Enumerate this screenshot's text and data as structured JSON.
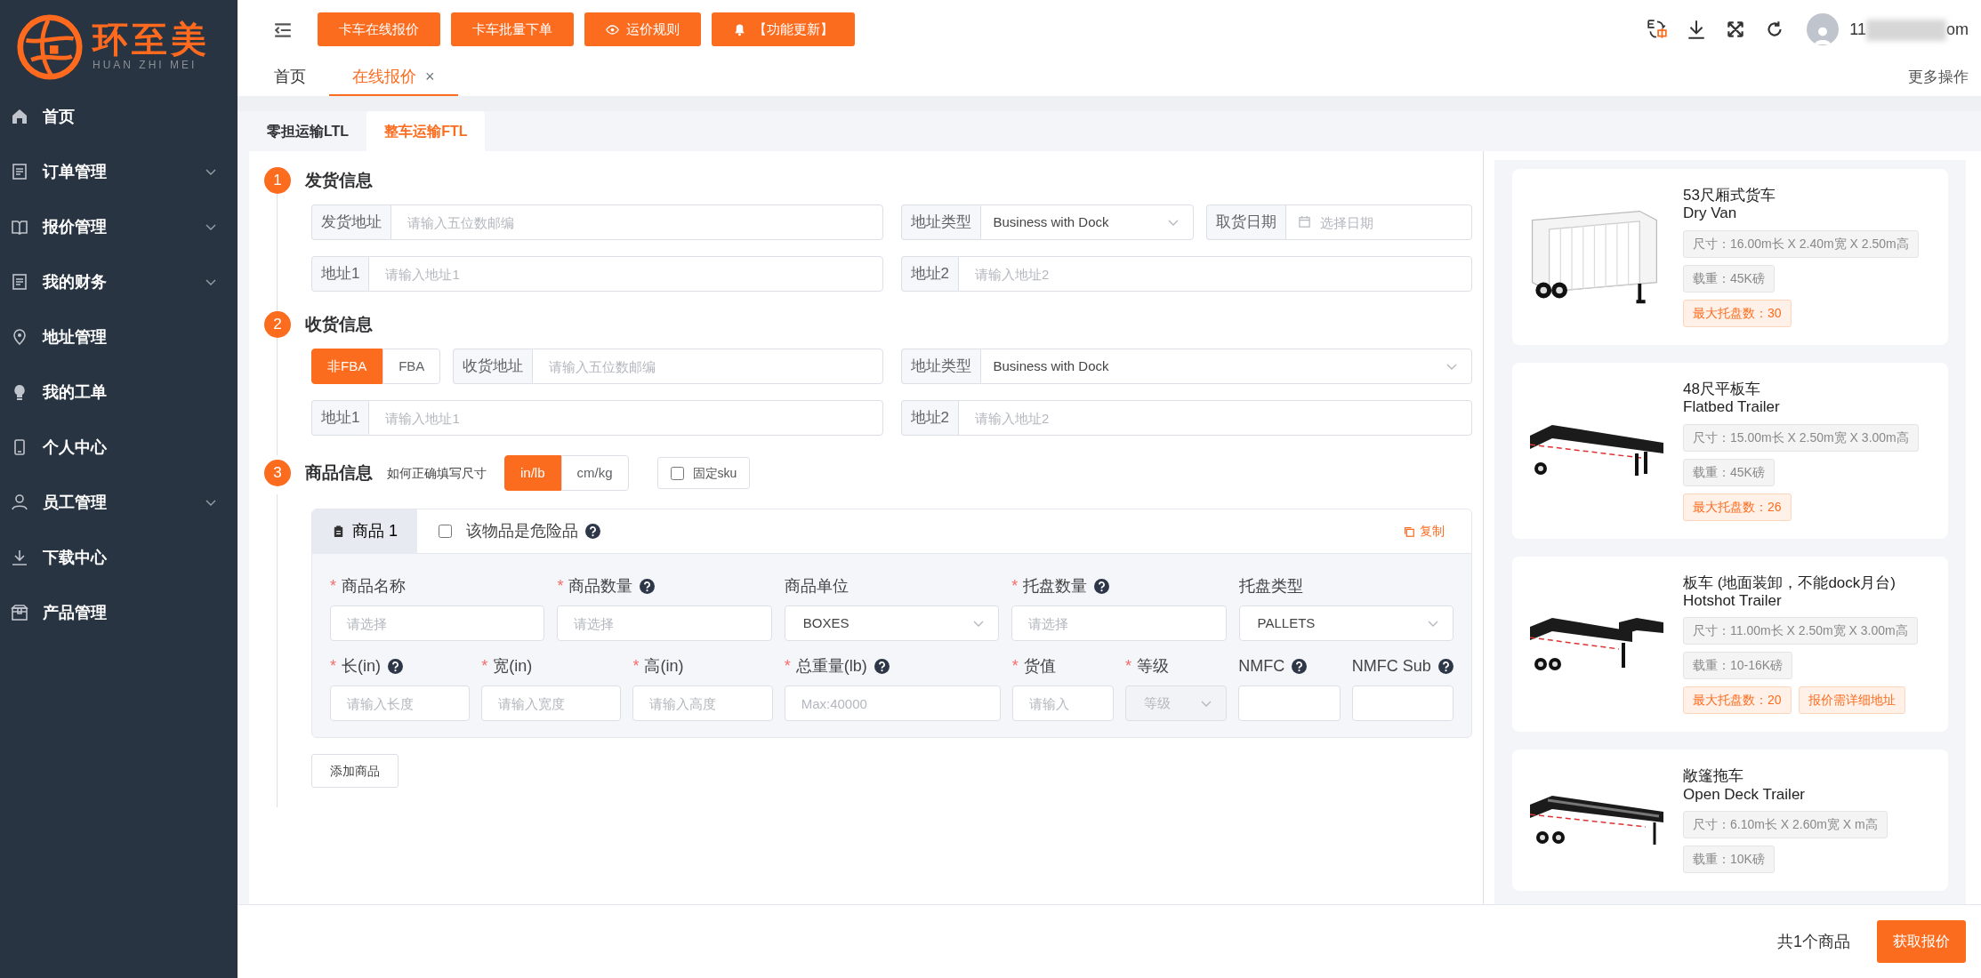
{
  "logo": {
    "name": "环至美",
    "subtitle": "HUAN ZHI MEI"
  },
  "sidebar": {
    "items": [
      {
        "label": "首页",
        "expandable": false
      },
      {
        "label": "订单管理",
        "expandable": true
      },
      {
        "label": "报价管理",
        "expandable": true
      },
      {
        "label": "我的财务",
        "expandable": true
      },
      {
        "label": "地址管理",
        "expandable": false
      },
      {
        "label": "我的工单",
        "expandable": false
      },
      {
        "label": "个人中心",
        "expandable": false
      },
      {
        "label": "员工管理",
        "expandable": true
      },
      {
        "label": "下载中心",
        "expandable": false
      },
      {
        "label": "产品管理",
        "expandable": false
      }
    ]
  },
  "toolbar": {
    "buttons": [
      {
        "label": "卡车在线报价",
        "kind": "text"
      },
      {
        "label": "卡车批量下单",
        "kind": "text"
      },
      {
        "label": "运价规则",
        "kind": "eye"
      },
      {
        "label": "【功能更新】",
        "kind": "bell"
      }
    ]
  },
  "user": {
    "visible_start": "11",
    "visible_end": "om"
  },
  "page_tabs": [
    {
      "label": "首页",
      "selected": false
    },
    {
      "label": "在线报价",
      "selected": true,
      "close": "×"
    }
  ],
  "more_actions": "更多操作",
  "mode_tabs": [
    {
      "label": "零担运输LTL",
      "selected": false
    },
    {
      "label": "整车运输FTL",
      "selected": true
    }
  ],
  "sections": [
    {
      "number": "1",
      "title": "发货信息",
      "rows": [
        {
          "left": [
            {
              "kind": "input",
              "label": "发货地址",
              "placeholder": "请输入五位数邮编"
            }
          ],
          "right": [
            {
              "kind": "select",
              "label": "地址类型",
              "value": "Business with Dock"
            },
            {
              "kind": "date",
              "label": "取货日期",
              "placeholder": "选择日期"
            }
          ]
        },
        {
          "left": [
            {
              "kind": "input",
              "label": "地址1",
              "placeholder": "请输入地址1"
            }
          ],
          "right": [
            {
              "kind": "input",
              "label": "地址2",
              "placeholder": "请输入地址2"
            }
          ]
        }
      ]
    },
    {
      "number": "2",
      "title": "收货信息",
      "rows": [
        {
          "left": [
            {
              "kind": "toggle",
              "options": [
                {
                  "label": "非FBA",
                  "selected": true
                },
                {
                  "label": "FBA",
                  "selected": false
                }
              ]
            },
            {
              "kind": "input",
              "label": "收货地址",
              "placeholder": "请输入五位数邮编"
            }
          ],
          "right": [
            {
              "kind": "select",
              "label": "地址类型",
              "value": "Business with Dock"
            }
          ]
        },
        {
          "left": [
            {
              "kind": "input",
              "label": "地址1",
              "placeholder": "请输入地址1"
            }
          ],
          "right": [
            {
              "kind": "input",
              "label": "地址2",
              "placeholder": "请输入地址2"
            }
          ]
        }
      ]
    }
  ],
  "goods": {
    "number": "3",
    "title": "商品信息",
    "hint": "如何正确填写尺寸",
    "units": [
      {
        "label": "in/lb",
        "selected": true
      },
      {
        "label": "cm/kg",
        "selected": false
      }
    ],
    "fixed_sku": {
      "label": "固定sku",
      "checked": false
    },
    "item_tab": "商品 1",
    "dangerous": {
      "label": "该物品是危险品",
      "checked": false
    },
    "copy": "复制",
    "rows": [
      {
        "fields": [
          {
            "label": "商品名称",
            "marker": "*",
            "help": false,
            "kind": "input",
            "placeholder": "请选择"
          },
          {
            "label": "商品数量",
            "marker": "*",
            "help": true,
            "kind": "input",
            "placeholder": "请选择"
          },
          {
            "label": "商品单位",
            "help": false,
            "kind": "select",
            "value": "BOXES"
          },
          {
            "label": "托盘数量",
            "marker": "*",
            "help": true,
            "kind": "input",
            "placeholder": "请选择"
          },
          {
            "label": "托盘类型",
            "help": false,
            "kind": "select",
            "value": "PALLETS"
          }
        ]
      },
      {
        "fields": [
          {
            "label": "长(in)",
            "marker": "*",
            "help": true,
            "kind": "input",
            "placeholder": "请输入长度"
          },
          {
            "label": "宽(in)",
            "marker": "*",
            "help": false,
            "kind": "input",
            "placeholder": "请输入宽度"
          },
          {
            "label": "高(in)",
            "marker": "*",
            "help": false,
            "kind": "input",
            "placeholder": "请输入高度"
          },
          {
            "label": "总重量(lb)",
            "marker": "*",
            "help": true,
            "kind": "input",
            "placeholder": "Max:40000"
          },
          {
            "label": "货值",
            "marker": "*",
            "help": false,
            "kind": "input",
            "placeholder": "请输入"
          },
          {
            "label": "等级",
            "marker": "*",
            "help": false,
            "kind": "select",
            "placeholder": "等级",
            "disabled": true
          },
          {
            "label": "NMFC",
            "help": true,
            "kind": "input"
          },
          {
            "label": "NMFC Sub",
            "help": true,
            "kind": "input"
          }
        ]
      }
    ],
    "add_button": "添加商品"
  },
  "trucks": [
    {
      "kind": "van",
      "title": "53尺厢式货车",
      "name": "Dry Van",
      "tags": [
        {
          "kind": "spec",
          "text": "尺寸：16.00m长 X 2.40m宽 X 2.50m高"
        },
        {
          "kind": "spec",
          "text": "载重：45K磅"
        },
        {
          "kind": "highlight",
          "text": "最大托盘数：30"
        }
      ]
    },
    {
      "kind": "flatbed",
      "title": "48尺平板车",
      "name": "Flatbed Trailer",
      "tags": [
        {
          "kind": "spec",
          "text": "尺寸：15.00m长 X 2.50m宽 X 3.00m高"
        },
        {
          "kind": "spec",
          "text": "载重：45K磅"
        },
        {
          "kind": "highlight",
          "text": "最大托盘数：26"
        }
      ]
    },
    {
      "kind": "gooseneck",
      "title": "板车 (地面装卸，不能dock月台)",
      "name": "Hotshot Trailer",
      "tags": [
        {
          "kind": "spec",
          "text": "尺寸：11.00m长 X 2.50m宽 X 3.00m高"
        },
        {
          "kind": "spec",
          "text": "载重：10-16K磅"
        },
        {
          "kind": "highlight",
          "text": "最大托盘数：20"
        },
        {
          "kind": "highlight",
          "text": "报价需详细地址"
        }
      ]
    },
    {
      "kind": "open-deck",
      "title": "敞篷拖车",
      "name": "Open Deck Trailer",
      "tags": [
        {
          "kind": "spec",
          "text": "尺寸：6.10m长 X 2.60m宽 X m高"
        },
        {
          "kind": "spec",
          "text": "载重：10K磅"
        }
      ]
    }
  ],
  "footer": {
    "count": "共1个商品",
    "submit": "获取报价"
  }
}
